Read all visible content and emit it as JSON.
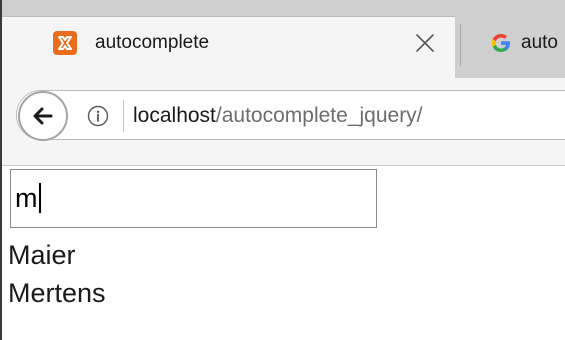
{
  "browser": {
    "tabs": [
      {
        "title": "autocomplete",
        "favicon": "xampp-icon",
        "active": true
      },
      {
        "title": "auto",
        "favicon": "google-icon",
        "active": false
      }
    ],
    "address": {
      "host": "localhost",
      "path": "/autocomplete_jquery/"
    }
  },
  "page": {
    "search": {
      "value": "m"
    },
    "suggestions": [
      "Maier",
      "Mertens"
    ]
  },
  "colors": {
    "tab_strip": "#cfcfcf",
    "toolbar": "#f5f5f5",
    "xampp_orange": "#ea6d1c",
    "url_path_gray": "#6d6d6d"
  }
}
